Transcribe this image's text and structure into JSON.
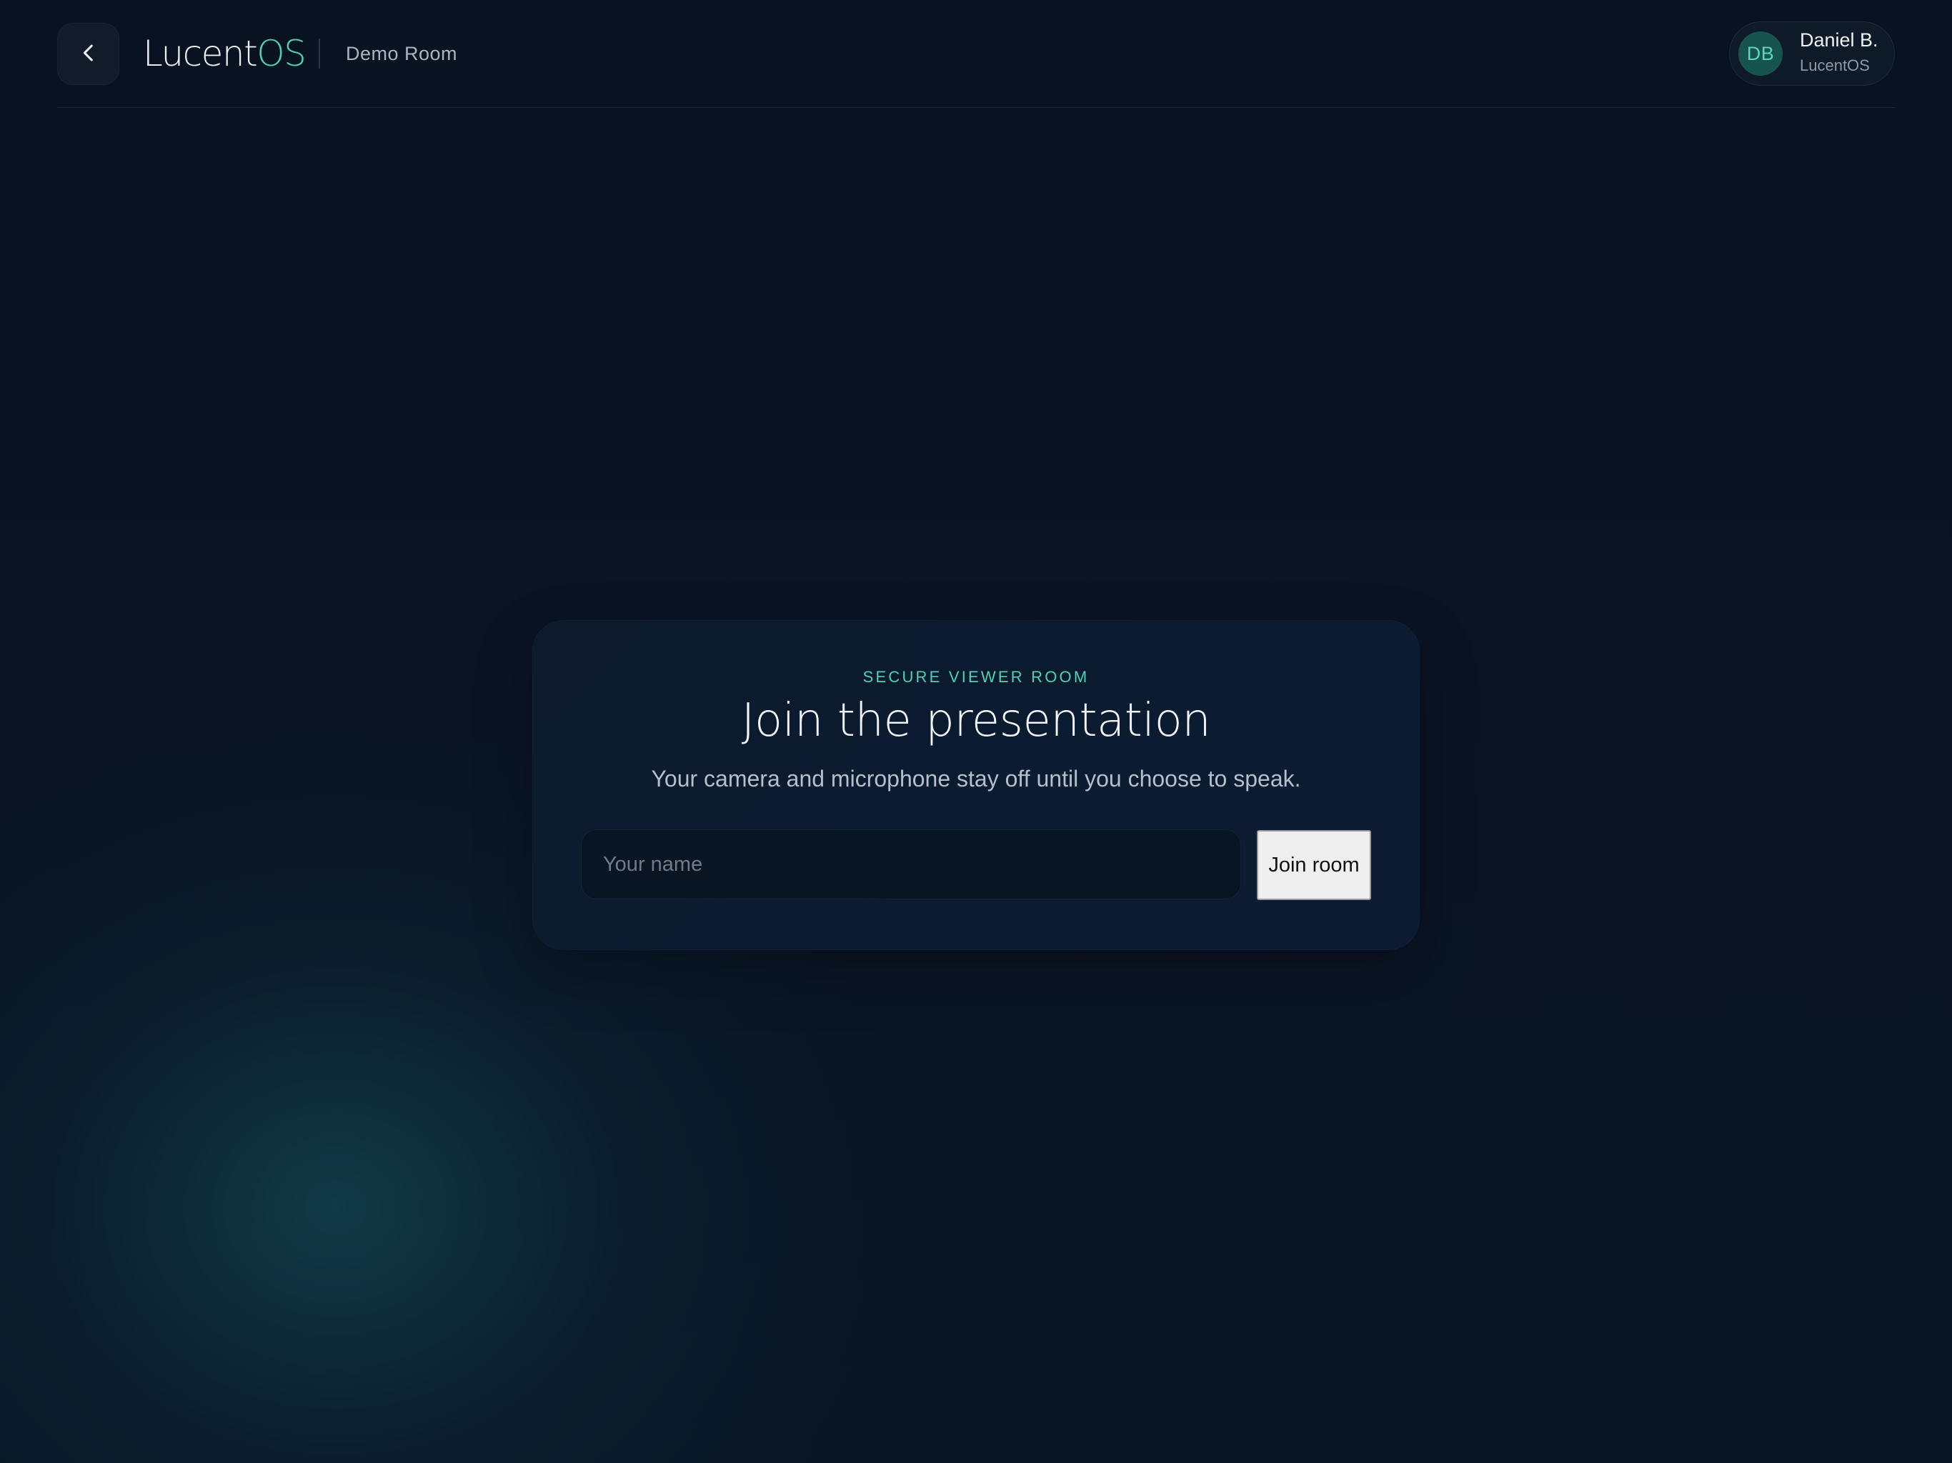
{
  "header": {
    "back_icon": "chevron-left-icon",
    "brand": {
      "main": "Lucent",
      "accent": "OS"
    },
    "room_name": "Demo Room",
    "user": {
      "initials": "DB",
      "name": "Daniel B.",
      "org": "LucentOS"
    }
  },
  "join_card": {
    "eyebrow": "SECURE VIEWER ROOM",
    "title": "Join the presentation",
    "subtitle": "Your camera and microphone stay off until you choose to speak.",
    "name_input": {
      "value": "",
      "placeholder": "Your name"
    },
    "join_button_label": "Join room"
  },
  "colors": {
    "accent": "#4fd1b4",
    "background": "#0a1424",
    "card": "#0b1a2e"
  }
}
